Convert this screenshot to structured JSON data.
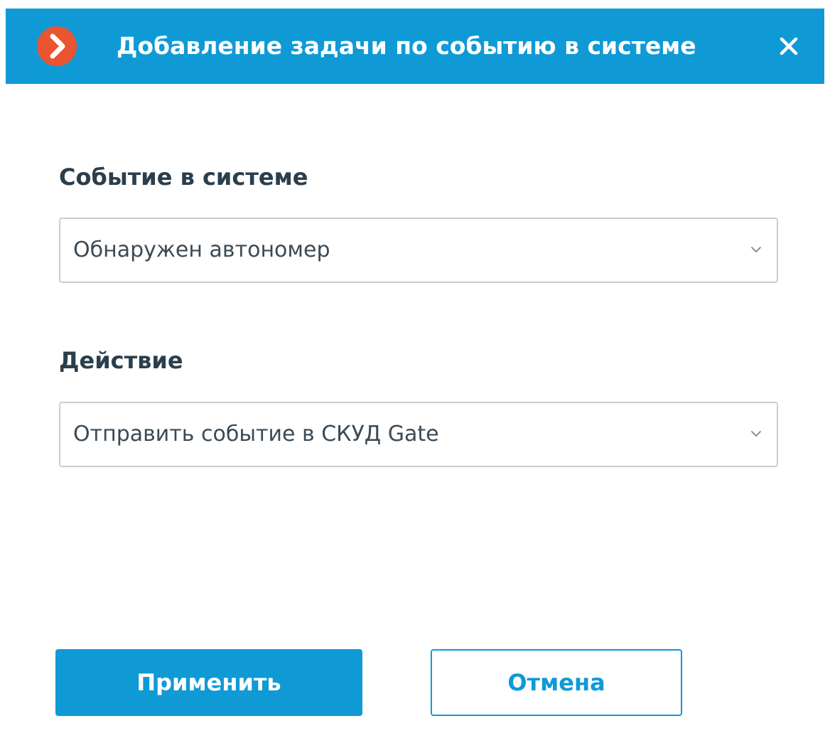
{
  "dialog": {
    "title": "Добавление задачи по событию в системе",
    "icons": {
      "app_logo": "chevron-right-circle-icon",
      "close": "close-icon"
    },
    "colors": {
      "accent": "#0f9ad6",
      "logo": "#ea5431",
      "label_text": "#2b3e4c"
    }
  },
  "form": {
    "event_label": "Событие в системе",
    "event_value": "Обнаружен автономер",
    "action_label": "Действие",
    "action_value": "Отправить событие в СКУД Gate"
  },
  "buttons": {
    "apply_label": "Применить",
    "cancel_label": "Отмена"
  }
}
